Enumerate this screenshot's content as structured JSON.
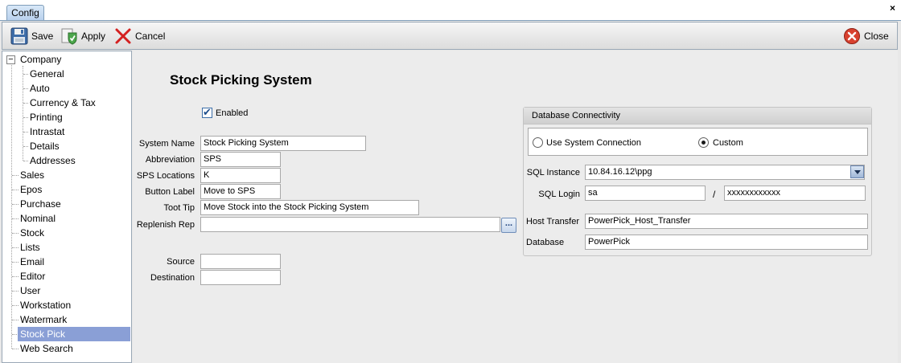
{
  "tab": {
    "label": "Config",
    "close_glyph": "×"
  },
  "toolbar": {
    "save_label": "Save",
    "apply_label": "Apply",
    "cancel_label": "Cancel",
    "close_label": "Close"
  },
  "tree": {
    "root": {
      "label": "Company",
      "expander": "−"
    },
    "company_children": [
      "General",
      "Auto",
      "Currency & Tax",
      "Printing",
      "Intrastat",
      "Details",
      "Addresses"
    ],
    "items": [
      "Sales",
      "Epos",
      "Purchase",
      "Nominal",
      "Stock",
      "Lists",
      "Email",
      "Editor",
      "User",
      "Workstation",
      "Watermark",
      "Stock Pick",
      "Web Search"
    ],
    "selected": "Stock Pick"
  },
  "page": {
    "title": "Stock Picking System",
    "enabled_label": "Enabled",
    "enabled": true
  },
  "form": {
    "system_name": {
      "label": "System Name",
      "value": "Stock Picking System"
    },
    "abbreviation": {
      "label": "Abbreviation",
      "value": "SPS"
    },
    "sps_locations": {
      "label": "SPS Locations",
      "value": "K"
    },
    "button_label": {
      "label": "Button Label",
      "value": "Move to SPS"
    },
    "toot_tip": {
      "label": "Toot Tip",
      "value": "Move Stock into the Stock Picking System"
    },
    "replenish_rep": {
      "label": "Replenish Rep",
      "value": "",
      "button": "..."
    },
    "source": {
      "label": "Source",
      "value": ""
    },
    "destination": {
      "label": "Destination",
      "value": ""
    }
  },
  "db": {
    "title": "Database Connectivity",
    "radio_system": "Use System Connection",
    "radio_custom": "Custom",
    "selected": "Custom",
    "sql_instance": {
      "label": "SQL Instance",
      "value": "10.84.16.12\\ppg"
    },
    "sql_login": {
      "label": "SQL Login",
      "user": "sa",
      "separator": "/",
      "password": "xxxxxxxxxxxx"
    },
    "host_transfer": {
      "label": "Host Transfer",
      "value": "PowerPick_Host_Transfer"
    },
    "database": {
      "label": "Database",
      "value": "PowerPick"
    }
  },
  "colors": {
    "selection": "#8a9fd6",
    "cancel_red": "#d42020",
    "close_red": "#d8412f"
  }
}
